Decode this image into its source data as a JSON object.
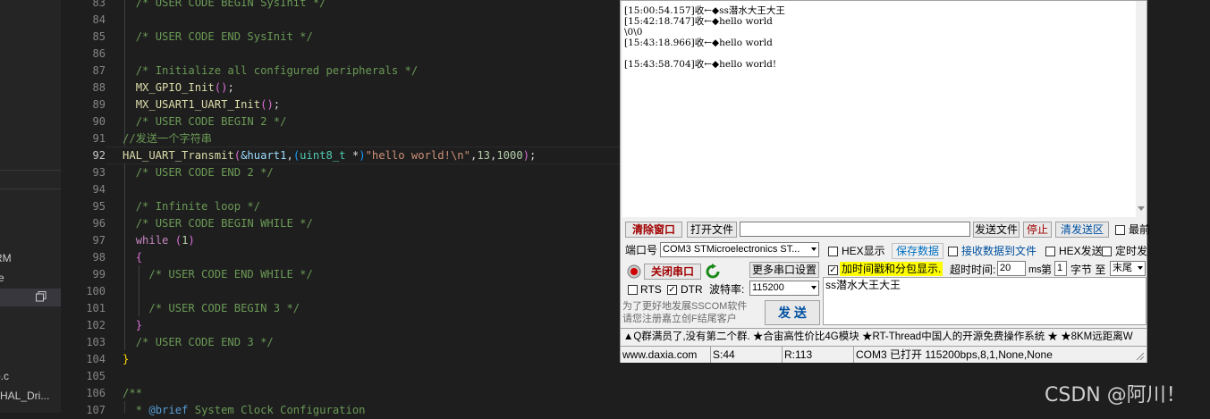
{
  "explorer": {
    "items": [
      {
        "label": "RM"
      },
      {
        "label": "re"
      },
      {
        "label": "o.c"
      },
      {
        "label": "HAL_Dri..."
      }
    ],
    "copy_icon": "copy-icon"
  },
  "editor": {
    "active_line": "92",
    "line_numbers": [
      "83",
      "84",
      "85",
      "86",
      "87",
      "88",
      "89",
      "90",
      "91",
      "92",
      "93",
      "94",
      "95",
      "96",
      "97",
      "98",
      "99",
      "100",
      "101",
      "102",
      "103",
      "104",
      "105",
      "106",
      "107"
    ],
    "lines": {
      "l83": "/* USER CODE BEGIN SysInit */",
      "l85": "/* USER CODE END SysInit */",
      "l87": "/* Initialize all configured peripherals */",
      "l88_fn": "MX_GPIO_Init",
      "l89_fn": "MX_USART1_UART_Init",
      "l90": "/* USER CODE BEGIN 2 */",
      "l91": "//发送一个字符串",
      "l92_fn": "HAL_UART_Transmit",
      "l92_var": "&huart1",
      "l92_type": "uint8_t",
      "l92_str": "\"hello world!\\n\"",
      "l92_n1": "13",
      "l92_n2": "1000",
      "l93": "/* USER CODE END 2 */",
      "l95": "/* Infinite loop */",
      "l96": "/* USER CODE BEGIN WHILE */",
      "l97_kw": "while",
      "l97_num": "1",
      "l99": "/* USER CODE END WHILE */",
      "l101": "/* USER CODE BEGIN 3 */",
      "l103": "/* USER CODE END 3 */",
      "l106": "/**",
      "l107_tag": "@brief",
      "l107_text": "System Clock Configuration"
    }
  },
  "serial": {
    "receive_lines": [
      "[15:00:54.157]收←◆ss潜水大王大王",
      "[15:42:18.747]收←◆hello world",
      "\\0\\0",
      "[15:43:18.966]收←◆hello world",
      "",
      "[15:43:58.704]收←◆hello world!"
    ],
    "toolbar": {
      "clear_window": "清除窗口",
      "open_file": "打开文件",
      "file_path": "",
      "send_file": "发送文件",
      "stop": "停止",
      "clear_send": "清发送区",
      "topmost": "最前"
    },
    "port_label": "端口号",
    "port_value": "COM3 STMicroelectronics ST...",
    "close_port": "关闭串口",
    "more_settings": "更多串口设置",
    "rts": "RTS",
    "dtr": "DTR",
    "baud_label": "波特率:",
    "baud_value": "115200",
    "promo": "为了更好地发展SSCOM软件\n请您注册嘉立创F结尾客户",
    "send_button": "发 送",
    "hex_display": "HEX显示",
    "save_data": "保存数据",
    "recv_to_file": "接收数据到文件",
    "hex_send": "HEX发送",
    "timed_send": "定时发",
    "timestamp": "加时间戳和分包显示.",
    "timeout_label": "超时时间:",
    "timeout_value": "20",
    "ms": "ms",
    "nth": "第",
    "byte_value": "1",
    "byte_label": "字节 至",
    "end_value": "末尾",
    "send_text": "ss潜水大王大王",
    "ticker": "▲Q群满员了,没有第二个群. ★合宙高性价比4G模块 ★RT-Thread中国人的开源免费操作系统 ★ ★8KM远距离W",
    "status": {
      "site": "www.daxia.com",
      "sent": "S:44",
      "recv": "R:113",
      "port": "COM3 已打开  115200bps,8,1,None,None"
    },
    "colors": {
      "close_port": "#a00000",
      "save_data": "#0070c0",
      "timestamp_bg": "#ffff00"
    }
  },
  "watermark": "CSDN @阿川！"
}
